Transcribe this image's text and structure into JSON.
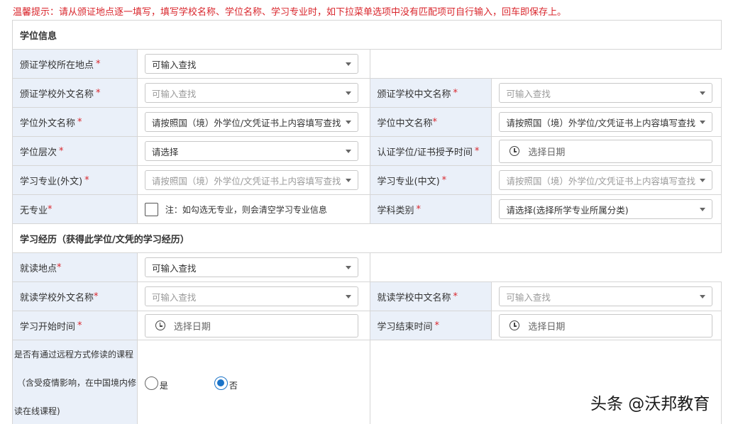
{
  "notice": "温馨提示：请从颁证地点逐一填写，填写学校名称、学位名称、学习专业时，如下拉菜单选项中没有匹配项可自行输入，回车即保存上。",
  "required_mark": "*",
  "degree_section": {
    "title": "学位信息",
    "location_label": "颁证学校所在地点",
    "location_value": "可输入查找",
    "school_foreign_label": "颁证学校外文名称",
    "school_foreign_placeholder": "可输入查找",
    "school_chinese_label": "颁证学校中文名称",
    "school_chinese_placeholder": "可输入查找",
    "degree_foreign_label": "学位外文名称",
    "degree_foreign_value": "请按照国（境）外学位/文凭证书上内容填写查找",
    "degree_chinese_label": "学位中文名称",
    "degree_chinese_value": "请按照国（境）外学位/文凭证书上内容填写查找",
    "degree_level_label": "学位层次",
    "degree_level_value": "请选择",
    "certified_time_label": "认证学位/证书授予时间",
    "certified_time_placeholder": "选择日期",
    "major_foreign_label": "学习专业(外文)",
    "major_foreign_placeholder": "请按照国（境）外学位/文凭证书上内容填写查找",
    "major_chinese_label": "学习专业(中文)",
    "major_chinese_placeholder": "请按照国（境）外学位/文凭证书上内容填写查找",
    "no_major_label": "无专业",
    "no_major_note": "注：如勾选无专业，则会清空学习专业信息",
    "discipline_label": "学科类别",
    "discipline_value": "请选择(选择所学专业所属分类)"
  },
  "study_section": {
    "title": "学习经历（获得此学位/文凭的学习经历）",
    "study_location_label": "就读地点",
    "study_location_value": "可输入查找",
    "study_school_foreign_label": "就读学校外文名称",
    "study_school_foreign_placeholder": "可输入查找",
    "study_school_chinese_label": "就读学校中文名称",
    "study_school_chinese_placeholder": "可输入查找",
    "start_time_label": "学习开始时间",
    "start_time_placeholder": "选择日期",
    "end_time_label": "学习结束时间",
    "end_time_placeholder": "选择日期",
    "remote_label_lines": [
      "是否有通过远程方式修读的课程",
      "（含受疫情影响，在中国境内修",
      "读在线课程)"
    ],
    "remote_yes": "是",
    "remote_no": "否",
    "remote_selected": "否"
  },
  "watermark": "头条 @沃邦教育",
  "colors": {
    "accent": "#1a73c8",
    "required": "#d9262c",
    "label_bg": "#eaf0f9"
  }
}
